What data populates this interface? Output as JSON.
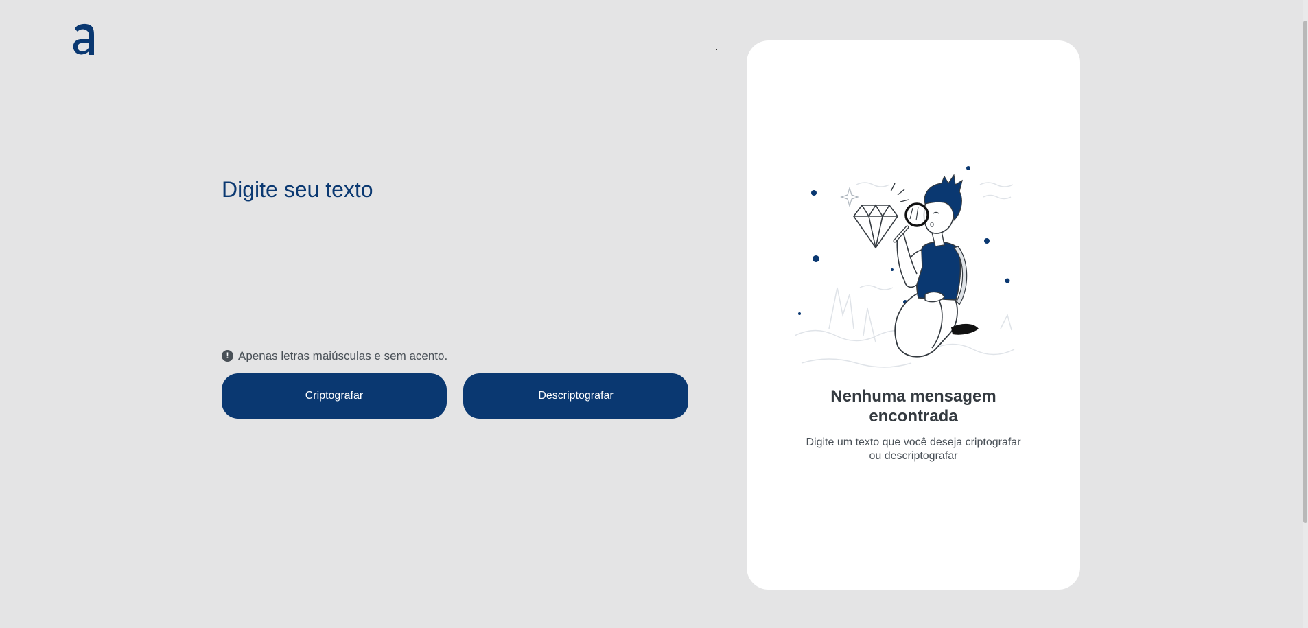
{
  "brand": {
    "logo_icon": "alura-a-logo",
    "color": "#0a3871"
  },
  "input": {
    "placeholder": "Digite seu texto",
    "value": ""
  },
  "hint": {
    "icon": "exclamation-circle-icon",
    "text": "Apenas letras maiúsculas e sem acento."
  },
  "actions": {
    "encrypt_label": "Criptografar",
    "decrypt_label": "Descriptografar"
  },
  "output": {
    "illustration": "person-with-magnifying-glass-and-diamond",
    "title_line1": "Nenhuma mensagem",
    "title_line2": "encontrada",
    "desc_line1": "Digite um texto que você deseja criptografar",
    "desc_line2": "ou descriptografar"
  },
  "colors": {
    "background": "#e4e4e5",
    "primary": "#0a3871",
    "text": "#343a40",
    "card": "#ffffff"
  }
}
